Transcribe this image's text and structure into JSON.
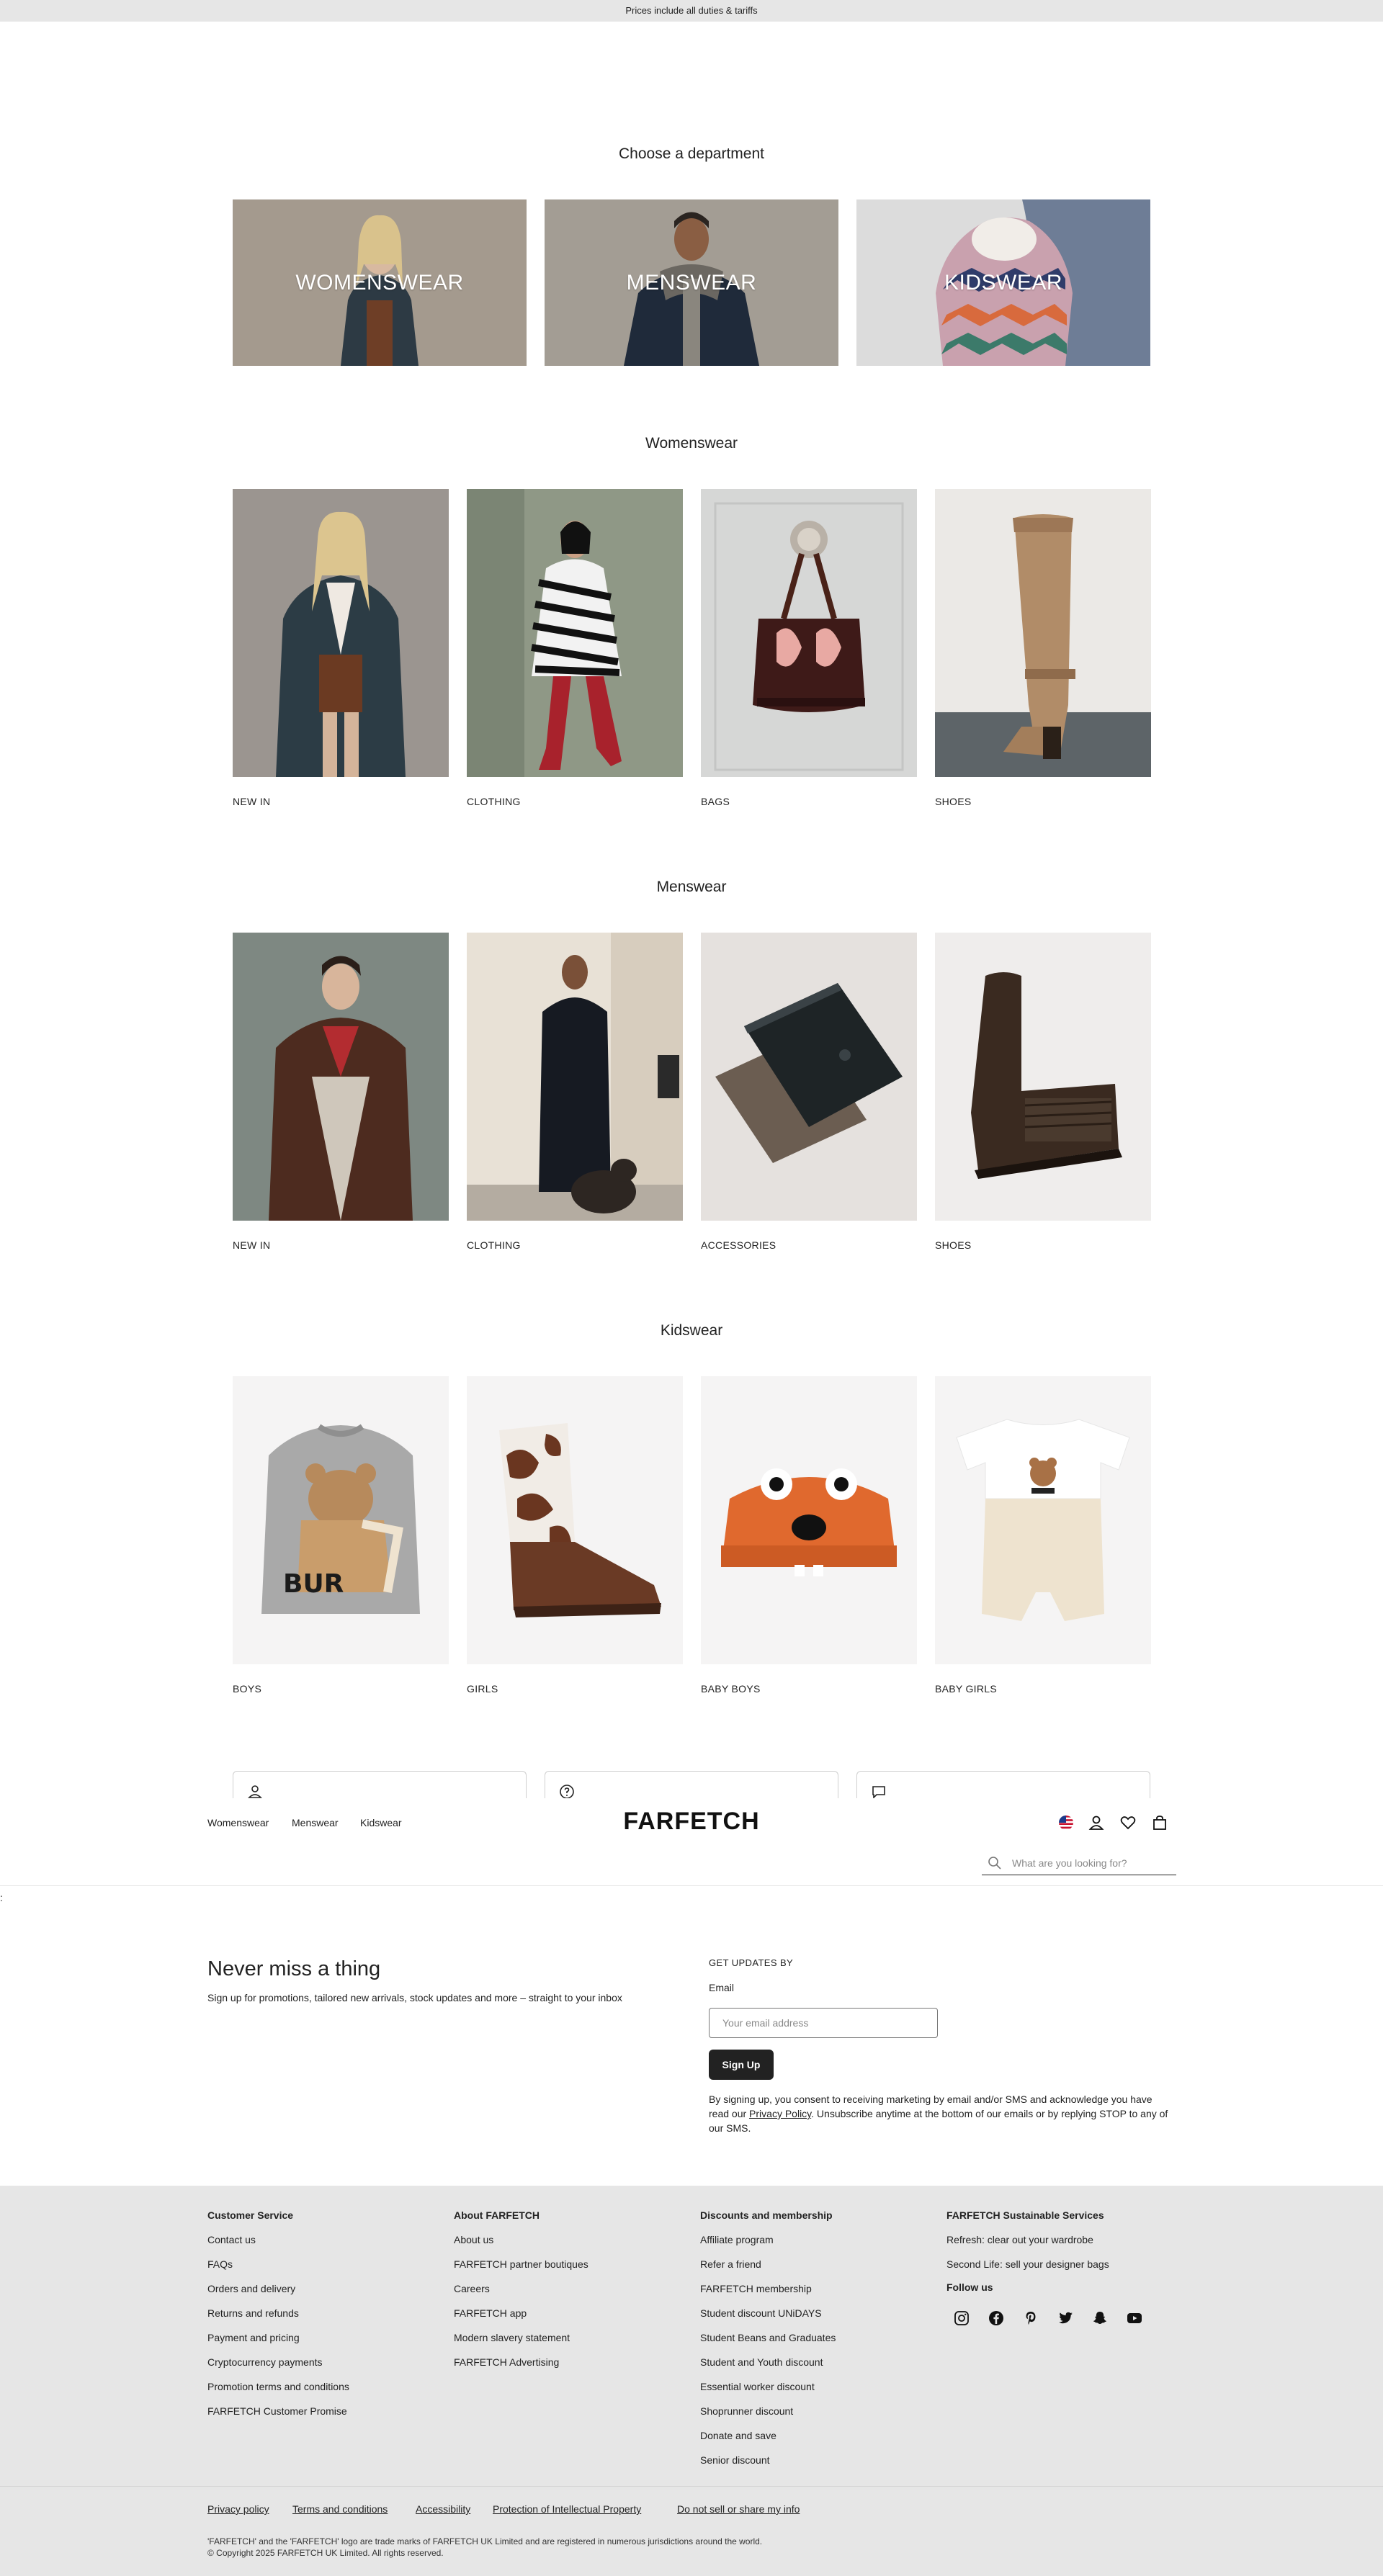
{
  "topbar": {
    "text": "Prices include all duties & tariffs"
  },
  "departments": {
    "title": "Choose a department",
    "tiles": [
      {
        "label": "WOMENSWEAR"
      },
      {
        "label": "MENSWEAR"
      },
      {
        "label": "KIDSWEAR"
      }
    ]
  },
  "womenswear": {
    "title": "Womenswear",
    "categories": [
      {
        "label": "NEW IN"
      },
      {
        "label": "CLOTHING"
      },
      {
        "label": "BAGS"
      },
      {
        "label": "SHOES"
      }
    ]
  },
  "menswear": {
    "title": "Menswear",
    "categories": [
      {
        "label": "NEW IN"
      },
      {
        "label": "CLOTHING"
      },
      {
        "label": "ACCESSORIES"
      },
      {
        "label": "SHOES"
      }
    ]
  },
  "kidswear": {
    "title": "Kidswear",
    "categories": [
      {
        "label": "BOYS"
      },
      {
        "label": "GIRLS"
      },
      {
        "label": "BABY BOYS"
      },
      {
        "label": "BABY GIRLS"
      }
    ]
  },
  "header": {
    "nav": [
      "Womenswear",
      "Menswear",
      "Kidswear"
    ],
    "logo": "FARFETCH",
    "search_placeholder": "What are you looking for?",
    "icons": [
      "us-flag-icon",
      "account-icon",
      "wishlist-heart-icon",
      "shopping-bag-icon"
    ]
  },
  "stray_text": ":",
  "newsletter": {
    "title": "Never miss a thing",
    "subtitle": "Sign up for promotions, tailored new arrivals, stock updates and more – straight to your inbox",
    "updates_label": "GET UPDATES BY",
    "email_label": "Email",
    "email_placeholder": "Your email address",
    "button": "Sign Up",
    "legal_before": "By signing up, you consent to receiving marketing by email and/or SMS and acknowledge you have read our ",
    "legal_link": "Privacy Policy",
    "legal_after": ". Unsubscribe anytime at the bottom of our emails or by replying STOP to any of our SMS."
  },
  "footer": {
    "columns": [
      {
        "title": "Customer Service",
        "links": [
          "Contact us",
          "FAQs",
          "Orders and delivery",
          "Returns and refunds",
          "Payment and pricing",
          "Cryptocurrency payments",
          "Promotion terms and conditions",
          "FARFETCH Customer Promise"
        ]
      },
      {
        "title": "About FARFETCH",
        "links": [
          "About us",
          "FARFETCH partner boutiques",
          "Careers",
          "FARFETCH app",
          "Modern slavery statement",
          "FARFETCH Advertising"
        ]
      },
      {
        "title": "Discounts and membership",
        "links": [
          "Affiliate program",
          "Refer a friend",
          "FARFETCH membership",
          "Student discount UNiDAYS",
          "Student Beans and Graduates",
          "Student and Youth discount",
          "Essential worker discount",
          "Shoprunner discount",
          "Donate and save",
          "Senior discount"
        ]
      },
      {
        "title": "FARFETCH Sustainable Services",
        "links": [
          "Refresh: clear out your wardrobe",
          "Second Life: sell your designer bags"
        ]
      }
    ],
    "follow_title": "Follow us",
    "social": [
      "instagram-icon",
      "facebook-icon",
      "pinterest-icon",
      "twitter-icon",
      "snapchat-icon",
      "youtube-icon"
    ],
    "legal_links": [
      "Privacy policy",
      "Terms and conditions",
      "Accessibility",
      "Protection of Intellectual Property",
      "Do not sell or share my info"
    ],
    "trademark": "'FARFETCH' and the 'FARFETCH' logo are trade marks of FARFETCH UK Limited and are registered in numerous jurisdictions around the world.",
    "copyright": "© Copyright 2025 FARFETCH UK Limited. All rights reserved."
  },
  "colors": {
    "topbar_bg": "#e6e6e6",
    "footer_bg": "#e6e6e6",
    "button_bg": "#222222"
  }
}
